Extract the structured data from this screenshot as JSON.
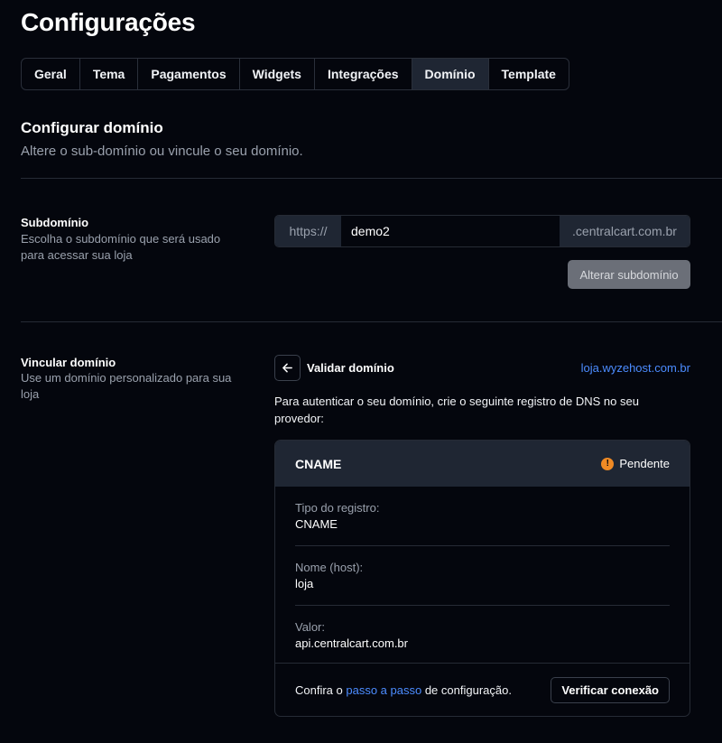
{
  "page": {
    "title": "Configurações"
  },
  "tabs": [
    {
      "label": "Geral"
    },
    {
      "label": "Tema"
    },
    {
      "label": "Pagamentos"
    },
    {
      "label": "Widgets"
    },
    {
      "label": "Integrações"
    },
    {
      "label": "Domínio",
      "active": true
    },
    {
      "label": "Template"
    }
  ],
  "section": {
    "title": "Configurar domínio",
    "subtitle": "Altere o sub-domínio ou vincule o seu domínio."
  },
  "subdomain": {
    "title": "Subdomínio",
    "description": "Escolha o subdomínio que será usado para acessar sua loja",
    "prefix": "https://",
    "value": "demo2",
    "suffix": ".centralcart.com.br",
    "button_label": "Alterar subdomínio"
  },
  "link_domain": {
    "title": "Vincular domínio",
    "description": "Use um domínio personalizado para sua loja",
    "back_icon": "arrow-left-icon",
    "validate_title": "Validar domínio",
    "domain": "loja.wyzehost.com.br",
    "instructions": "Para autenticar o seu domínio, crie o seguinte registro de DNS no seu provedor:"
  },
  "dns_card": {
    "type": "CNAME",
    "status_icon": "!",
    "status_label": "Pendente",
    "status_color": "#f08a24",
    "rows": [
      {
        "label": "Tipo do registro:",
        "value": "CNAME"
      },
      {
        "label": "Nome (host):",
        "value": "loja"
      },
      {
        "label": "Valor:",
        "value": "api.centralcart.com.br"
      }
    ],
    "footer_prefix": "Confira o ",
    "footer_link": "passo a passo",
    "footer_suffix": " de configuração.",
    "verify_label": "Verificar conexão"
  },
  "colors": {
    "accent_link": "#4c8cff",
    "background": "#04060d",
    "panel": "#1f2633"
  }
}
